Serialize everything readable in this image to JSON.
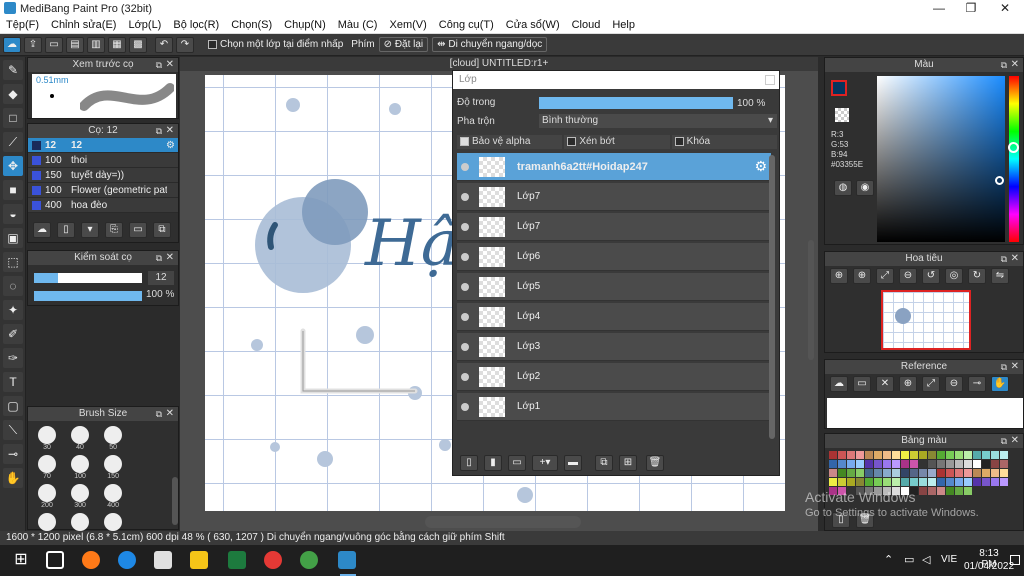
{
  "window": {
    "title": "MediBang Paint Pro (32bit)",
    "controls": {
      "minimize": "—",
      "maximize": "❐",
      "close": "✕"
    }
  },
  "menu": [
    "Tệp(F)",
    "Chỉnh sửa(E)",
    "Lớp(L)",
    "Bộ lọc(R)",
    "Chọn(S)",
    "Chụp(N)",
    "Màu (C)",
    "Xem(V)",
    "Công cụ(T)",
    "Cửa sổ(W)",
    "Cloud",
    "Help"
  ],
  "toolbar": {
    "select_layer_label": "Chọn một lớp tại điểm nhấp",
    "snap_label": "Phím",
    "reset_label": "Đặt lại",
    "move_label": "Di chuyển ngang/dọc"
  },
  "brush_preview": {
    "title": "Xem trước cọ",
    "size_label": "0.51mm"
  },
  "brush_panel": {
    "title": "Cọ: 12",
    "items": [
      {
        "size": "12",
        "name": "12",
        "selected": true
      },
      {
        "size": "100",
        "name": "thoi"
      },
      {
        "size": "150",
        "name": "tuyết dày=))"
      },
      {
        "size": "100",
        "name": "Flower (geometric patt"
      },
      {
        "size": "400",
        "name": "hoa đèo"
      }
    ]
  },
  "brush_control": {
    "title": "Kiểm soát cọ",
    "size_value": "12",
    "opacity_value": "100 %",
    "opacity": 1.0
  },
  "brush_size": {
    "title": "Brush Size",
    "sizes": [
      "30",
      "40",
      "50",
      "70",
      "100",
      "150",
      "200",
      "300",
      "400",
      "500",
      "700",
      "1000"
    ]
  },
  "document": {
    "tab_title": "[cloud] UNTITLED:r1+",
    "heading_text": "Hậu"
  },
  "layer_panel": {
    "title": "Lớp",
    "opacity_label": "Độ trong",
    "opacity_value": "100 %",
    "opacity": 1.0,
    "blend_label": "Pha trộn",
    "blend_value": "Bình thường",
    "protect_alpha": "Bảo vệ alpha",
    "clipping": "Xén bớt",
    "lock": "Khóa",
    "layers": [
      {
        "name": "tramanh6a2tt#Hoidap247",
        "selected": true
      },
      {
        "name": "Lớp7"
      },
      {
        "name": "Lớp7"
      },
      {
        "name": "Lớp6"
      },
      {
        "name": "Lớp5"
      },
      {
        "name": "Lớp4"
      },
      {
        "name": "Lớp3"
      },
      {
        "name": "Lớp2"
      },
      {
        "name": "Lớp1"
      }
    ]
  },
  "color_panel": {
    "title": "Màu",
    "r": "R:3",
    "g": "G:53",
    "b": "B:94",
    "hex": "#03355E",
    "current_color": "#03355e"
  },
  "navigator": {
    "title": "Hoa tiêu"
  },
  "reference": {
    "title": "Reference"
  },
  "palette": {
    "title": "Bảng màu"
  },
  "watermark": {
    "line1": "Activate Windows",
    "line2": "Go to Settings to activate Windows."
  },
  "status": {
    "text": "1600 * 1200 pixel  (6.8 * 5.1cm)  600 dpi  48 %  ( 630, 1207 )  Di chuyển ngang/vuông góc bằng cách giữ phím Shift"
  },
  "taskbar": {
    "time": "8:13 PM",
    "date": "01/04/2022",
    "lang": "VIE"
  }
}
